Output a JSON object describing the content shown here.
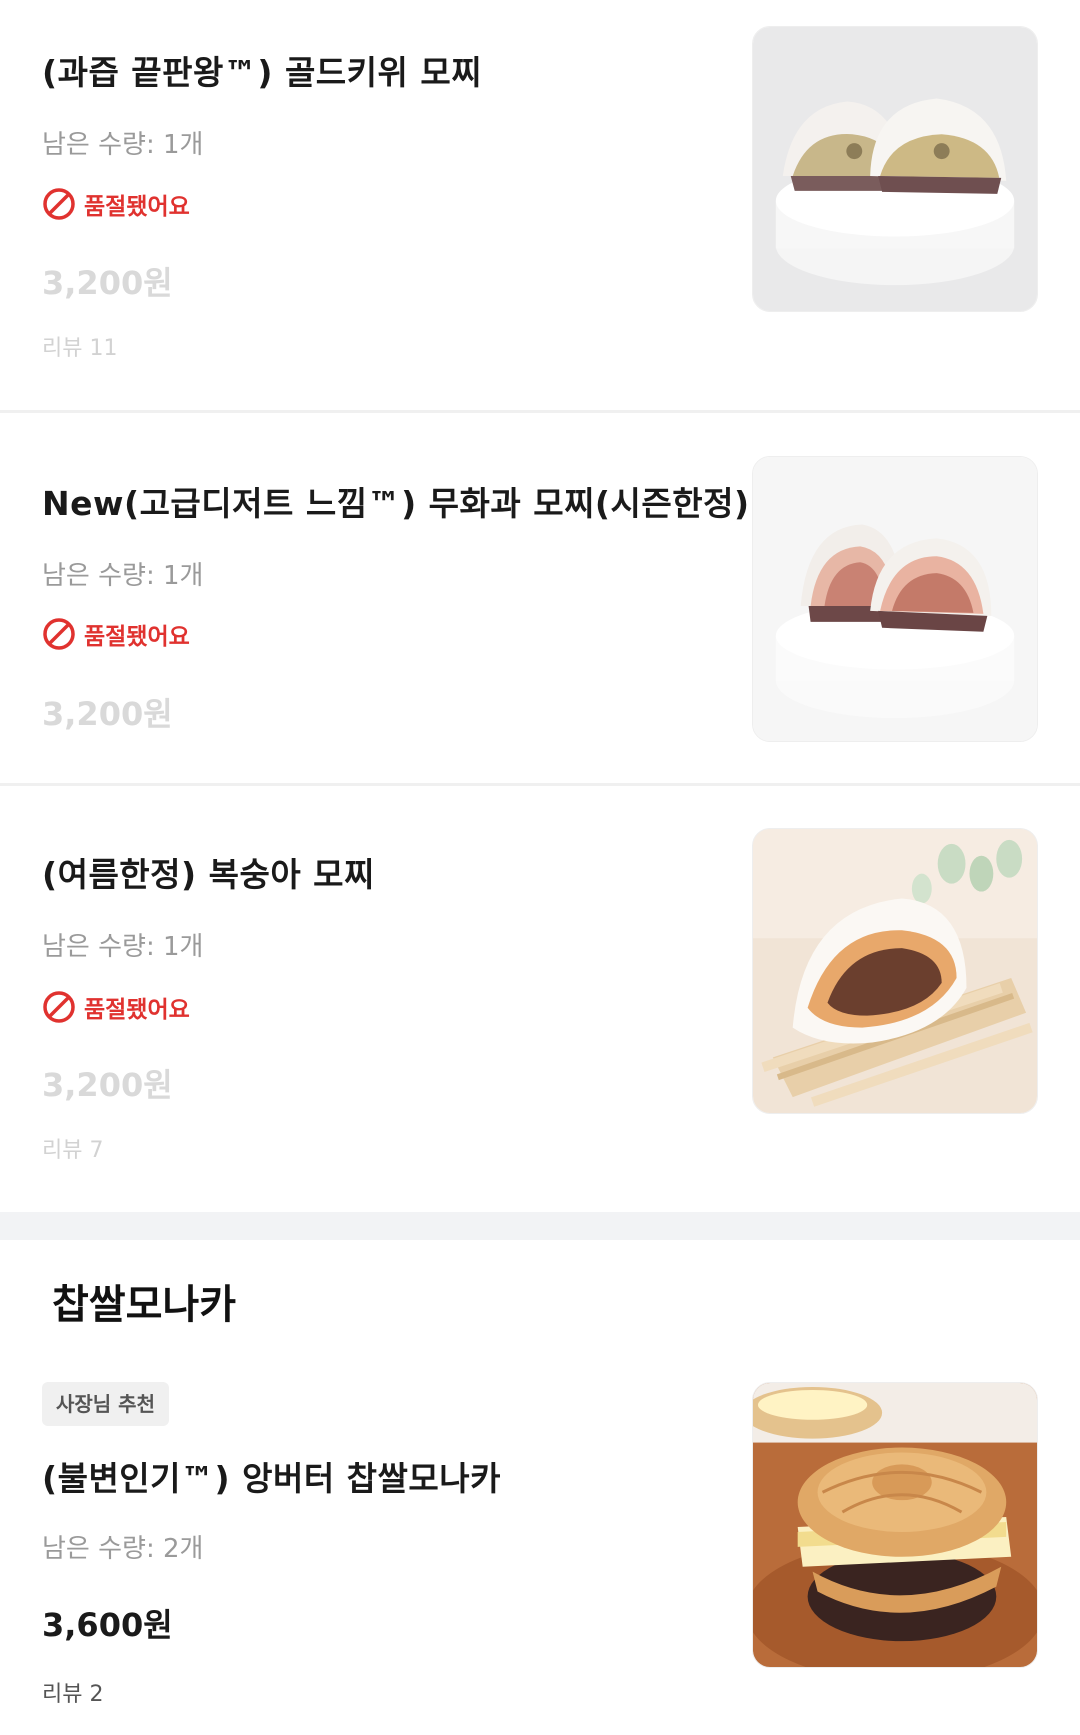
{
  "items": [
    {
      "name": "(과즙 끝판왕™) 골드키위 모찌",
      "quantity": "남은 수량: 1개",
      "soldout": "품절됐어요",
      "price": "3,200원",
      "review": "리뷰 11",
      "image": "gold-kiwi-mochi-photo"
    },
    {
      "name": "New(고급디저트 느낌™) 무화과 모찌(시즌한정)",
      "quantity": "남은 수량: 1개",
      "soldout": "품절됐어요",
      "price": "3,200원",
      "image": "fig-mochi-photo"
    },
    {
      "name": "(여름한정) 복숭아 모찌",
      "quantity": "남은 수량: 1개",
      "soldout": "품절됐어요",
      "price": "3,200원",
      "review": "리뷰 7",
      "image": "peach-mochi-photo"
    }
  ],
  "section": {
    "title": "찹쌀모나카"
  },
  "featured": {
    "badge": "사장님 추천",
    "name": "(불변인기™) 앙버터 찹쌀모나카",
    "quantity": "남은 수량: 2개",
    "price": "3,600원",
    "review": "리뷰 2",
    "image": "anbutter-monaka-photo"
  },
  "colors": {
    "soldout": "#e0322f",
    "price_disabled": "#d9d9d9",
    "price_active": "#1a1a1a",
    "section_bg": "#f2f3f5"
  },
  "icons": {
    "soldout": "prohibited-icon"
  }
}
